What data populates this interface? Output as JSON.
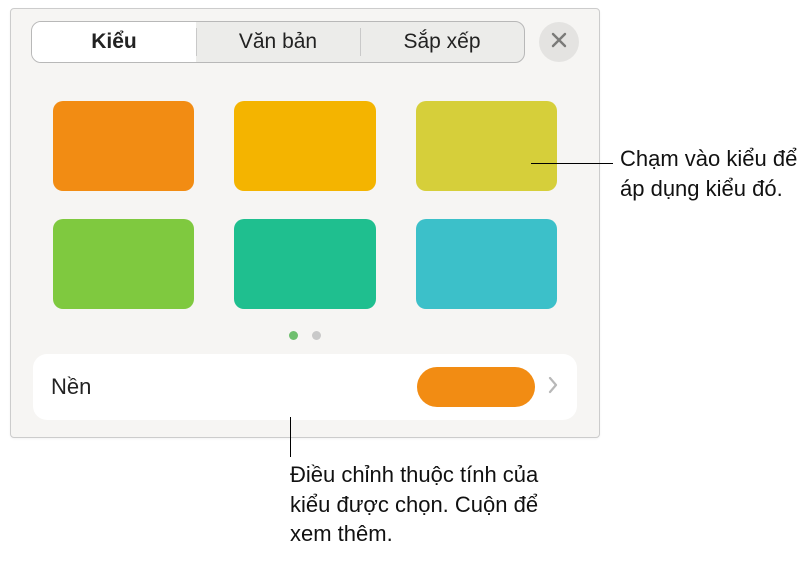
{
  "tabs": {
    "style": "Kiểu",
    "text": "Văn bản",
    "arrange": "Sắp xếp"
  },
  "swatches": [
    {
      "name": "orange",
      "color": "#f28c13"
    },
    {
      "name": "amber",
      "color": "#f4b400"
    },
    {
      "name": "olive",
      "color": "#d6cf3a"
    },
    {
      "name": "green",
      "color": "#7fc93f"
    },
    {
      "name": "teal",
      "color": "#1fbf8f"
    },
    {
      "name": "cyan",
      "color": "#3cc0c9"
    }
  ],
  "pager": {
    "count": 2,
    "active": 0
  },
  "background_row": {
    "label": "Nền",
    "swatch_color": "#f28c13"
  },
  "callouts": {
    "right": "Chạm vào kiểu để áp dụng kiểu đó.",
    "bottom": "Điều chỉnh thuộc tính của kiểu được chọn. Cuộn để xem thêm."
  }
}
